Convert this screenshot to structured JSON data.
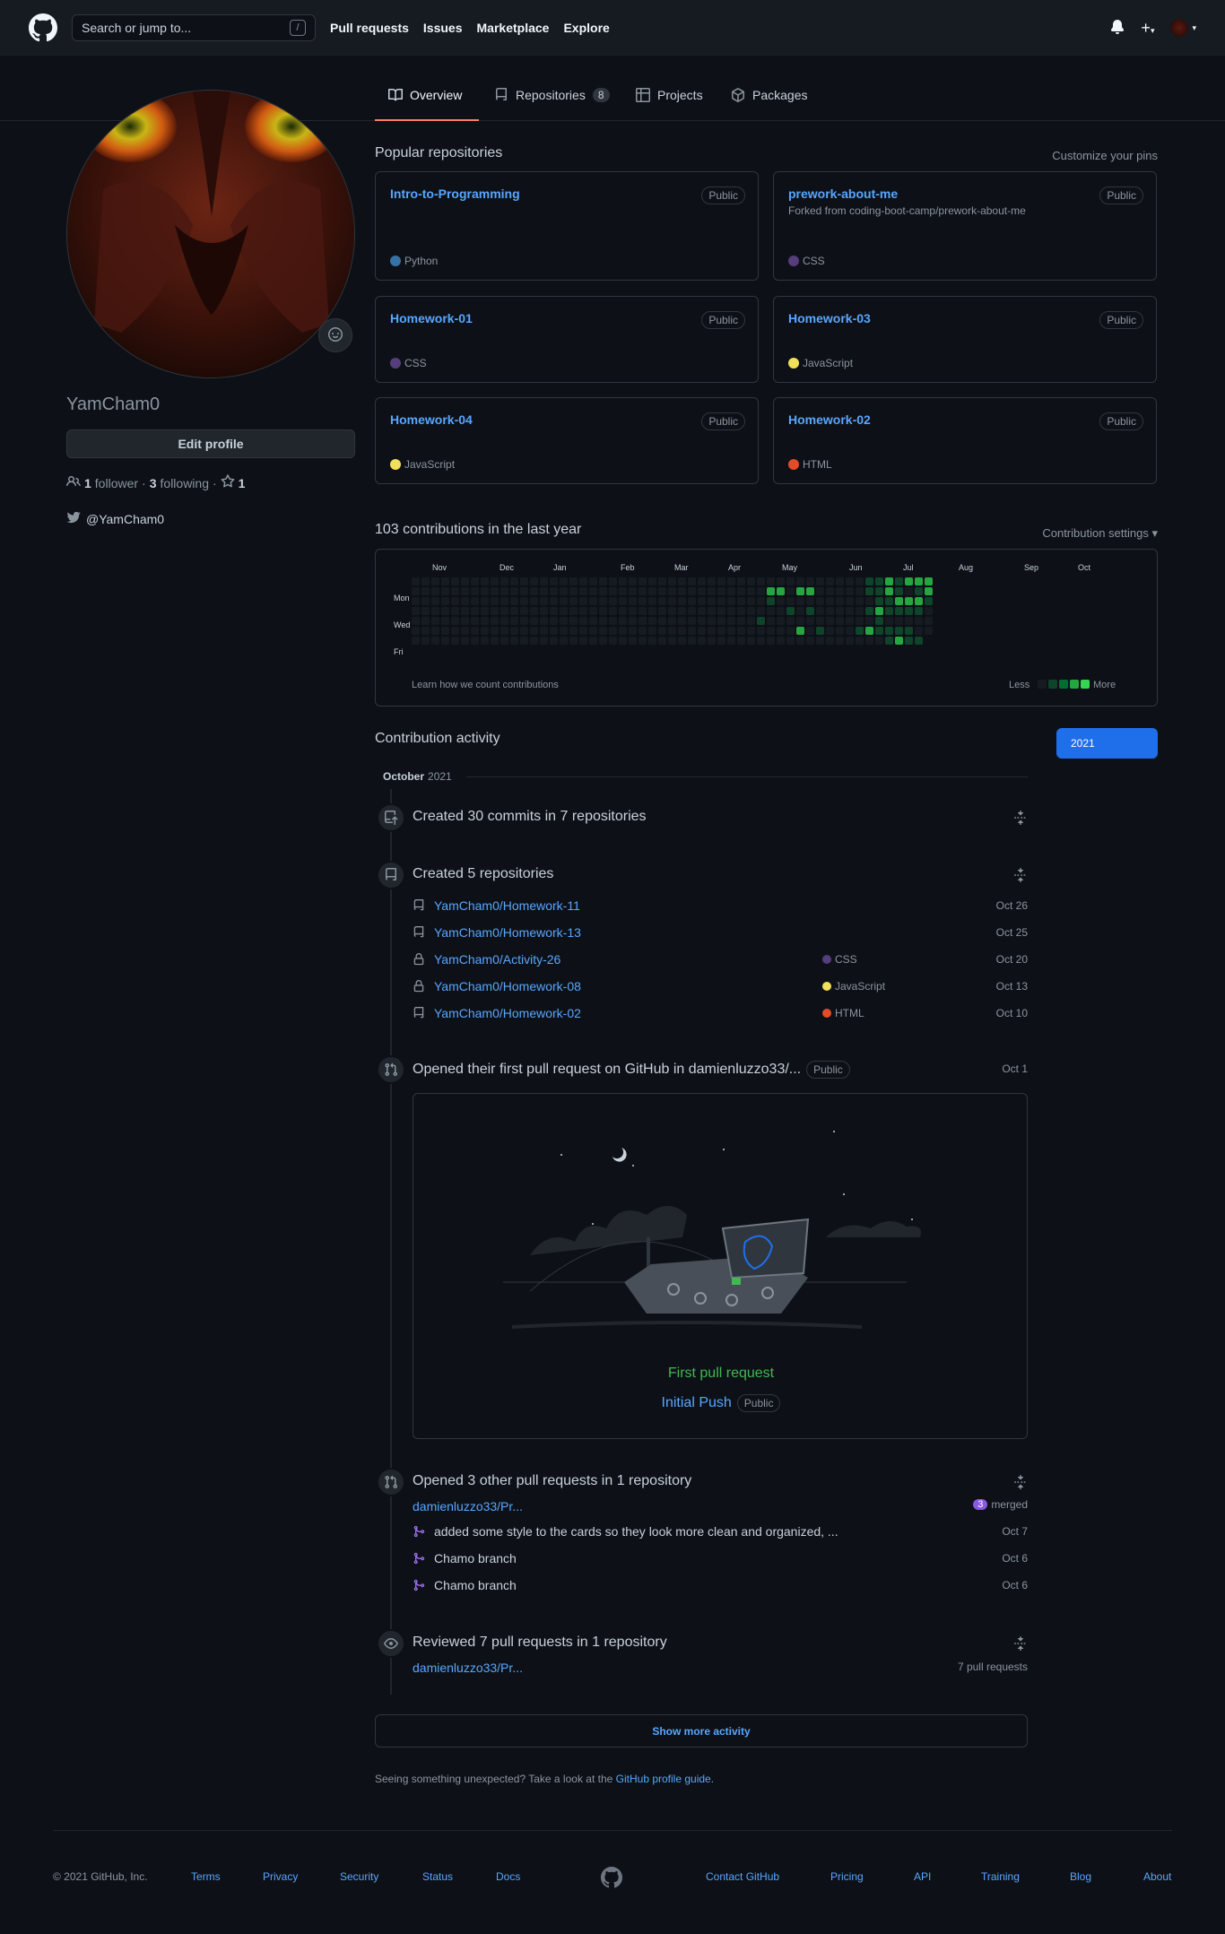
{
  "header": {
    "search_placeholder": "Search or jump to...",
    "search_key": "/",
    "nav": [
      "Pull requests",
      "Issues",
      "Marketplace",
      "Explore"
    ]
  },
  "tabs": [
    {
      "label": "Overview"
    },
    {
      "label": "Repositories",
      "count": "8"
    },
    {
      "label": "Projects"
    },
    {
      "label": "Packages"
    }
  ],
  "profile": {
    "username": "YamCham0",
    "edit_label": "Edit profile",
    "followers_count": "1",
    "followers_label": "follower",
    "following_count": "3",
    "following_label": "following",
    "stars_count": "1",
    "twitter": "@YamCham0"
  },
  "pinned": {
    "title": "Popular repositories",
    "customize": "Customize your pins",
    "items": [
      {
        "name": "Intro-to-Programming",
        "badge": "Public",
        "desc": "",
        "lang": "Python",
        "lang_color": "#3572A5"
      },
      {
        "name": "prework-about-me",
        "badge": "Public",
        "desc": "Forked from coding-boot-camp/prework-about-me",
        "lang": "CSS",
        "lang_color": "#563d7c"
      },
      {
        "name": "Homework-01",
        "badge": "Public",
        "desc": "",
        "lang": "CSS",
        "lang_color": "#563d7c"
      },
      {
        "name": "Homework-03",
        "badge": "Public",
        "desc": "",
        "lang": "JavaScript",
        "lang_color": "#f1e05a"
      },
      {
        "name": "Homework-04",
        "badge": "Public",
        "desc": "",
        "lang": "JavaScript",
        "lang_color": "#f1e05a"
      },
      {
        "name": "Homework-02",
        "badge": "Public",
        "desc": "",
        "lang": "HTML",
        "lang_color": "#e34c26"
      }
    ]
  },
  "contributions": {
    "title": "103 contributions in the last year",
    "settings": "Contribution settings ▾",
    "months": [
      "Nov",
      "Dec",
      "Jan",
      "Feb",
      "Mar",
      "Apr",
      "May",
      "Jun",
      "Jul",
      "Aug",
      "Sep",
      "Oct"
    ],
    "days": [
      "Mon",
      "Wed",
      "Fri"
    ],
    "learn": "Learn how we count contributions",
    "less": "Less",
    "more": "More"
  },
  "activity": {
    "title": "Contribution activity",
    "year": "2021",
    "month": "October",
    "month_year": "2021",
    "commits": "Created 30 commits in 7 repositories",
    "created": "Created 5 repositories",
    "repos": [
      {
        "name": "YamCham0/Homework-11",
        "lang": "",
        "lang_color": "",
        "date": "Oct 26",
        "private": false
      },
      {
        "name": "YamCham0/Homework-13",
        "lang": "",
        "lang_color": "",
        "date": "Oct 25",
        "private": false
      },
      {
        "name": "YamCham0/Activity-26",
        "lang": "CSS",
        "lang_color": "#563d7c",
        "date": "Oct 20",
        "private": true
      },
      {
        "name": "YamCham0/Homework-08",
        "lang": "JavaScript",
        "lang_color": "#f1e05a",
        "date": "Oct 13",
        "private": true
      },
      {
        "name": "YamCham0/Homework-02",
        "lang": "HTML",
        "lang_color": "#e34c26",
        "date": "Oct 10",
        "private": false
      }
    ],
    "first_pr": "Opened their first pull request on GitHub in damienluzzo33/...",
    "first_pr_badge": "Public",
    "first_pr_date": "Oct 1",
    "first_pr_label": "First pull request",
    "first_pr_title": "Initial Push",
    "first_pr_title_badge": "Public",
    "other_prs": "Opened 3 other pull requests in 1 repository",
    "other_repo": "damienluzzo33/Pr...",
    "merged_count": "3",
    "merged_label": "merged",
    "prs": [
      {
        "title": "added some style to the cards so they look more clean and organized, ...",
        "date": "Oct 7"
      },
      {
        "title": "Chamo branch",
        "date": "Oct 6"
      },
      {
        "title": "Chamo branch",
        "date": "Oct 6"
      }
    ],
    "reviewed": "Reviewed 7 pull requests in 1 repository",
    "reviewed_repo": "damienluzzo33/Pr...",
    "reviewed_count": "7 pull requests",
    "show_more": "Show more activity",
    "guide_prefix": "Seeing something unexpected? Take a look at the",
    "guide_link": "GitHub profile guide."
  },
  "footer": {
    "copyright": "© 2021 GitHub, Inc.",
    "left_links": [
      "Terms",
      "Privacy",
      "Security",
      "Status",
      "Docs"
    ],
    "right_links": [
      "Contact GitHub",
      "Pricing",
      "API",
      "Training",
      "Blog",
      "About"
    ]
  },
  "colors": {
    "accent": "#58a6ff",
    "bg": "#0d1117",
    "header": "#161b22",
    "green": "#3fb950",
    "blue_btn": "#1f6feb"
  }
}
